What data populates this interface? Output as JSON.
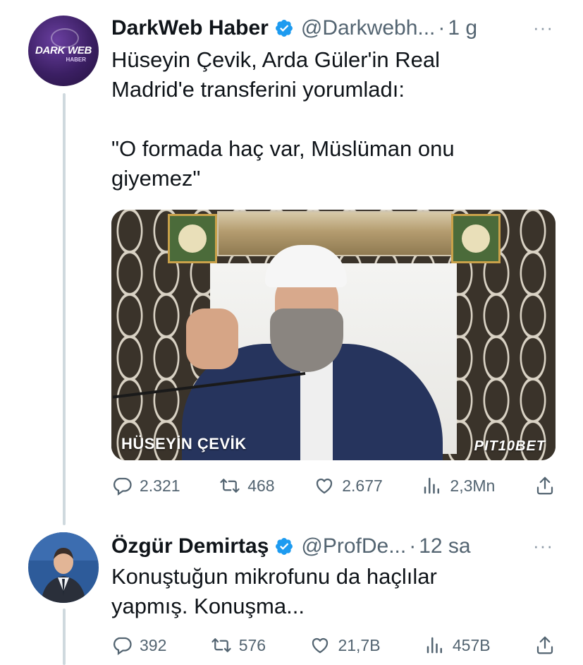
{
  "tweets": [
    {
      "author_name": "DarkWeb Haber",
      "handle": "@Darkwebh...",
      "separator": "·",
      "time": "1 g",
      "avatar_text": "DARK WEB",
      "avatar_subtext": "HABER",
      "text": "Hüseyin Çevik, Arda Güler'in Real\nMadrid'e transferini yorumladı:\n\n\"O formada haç var, Müslüman onu\ngiyemez\"",
      "media": {
        "caption_name": "HÜSEYİN ÇEVİK",
        "caption_brand": "PIT10BET"
      },
      "replies": "2.321",
      "retweets": "468",
      "likes": "2.677",
      "views": "2,3Mn"
    },
    {
      "author_name": "Özgür Demirtaş",
      "handle": "@ProfDe...",
      "separator": "·",
      "time": "12 sa",
      "text": "Konuştuğun mikrofunu da haçlılar\nyapmış. Konuşma...",
      "replies": "392",
      "retweets": "576",
      "likes": "21,7B",
      "views": "457B"
    }
  ],
  "more_label": "···",
  "colors": {
    "verified": "#1d9bf0",
    "secondary_text": "#536471",
    "thread_line": "#cfd9de"
  },
  "icons": [
    "reply-icon",
    "retweet-icon",
    "like-icon",
    "views-icon",
    "share-icon",
    "verified-badge-icon",
    "more-icon"
  ]
}
